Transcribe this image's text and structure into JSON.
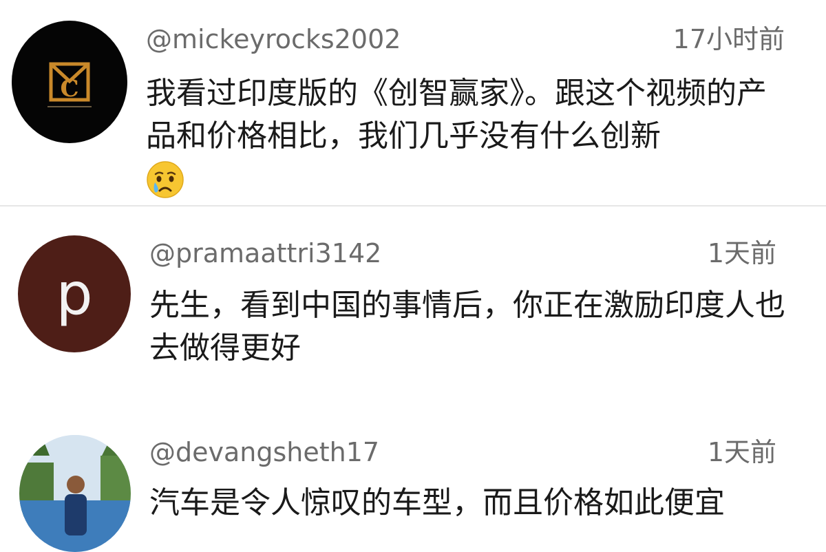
{
  "comments": [
    {
      "username": "@mickeyrocks2002",
      "time": "17小时前",
      "text": "我看过印度版的《创智赢家》。跟这个视频的产品和价格相比，我们几乎没有什么创新",
      "emoji": "crying-face",
      "avatar": {
        "type": "logo",
        "bg": "#050505",
        "accent": "#c9892a"
      }
    },
    {
      "username": "@pramaattri3142",
      "time": "1天前",
      "text": "先生，看到中国的事情后，你正在激励印度人也去做得更好",
      "avatar": {
        "type": "letter",
        "letter": "p",
        "bg": "#4e1e17"
      }
    },
    {
      "username": "@devangsheth17",
      "time": "1天前",
      "text": "汽车是令人惊叹的车型，而且价格如此便宜",
      "avatar": {
        "type": "photo"
      }
    }
  ],
  "colors": {
    "meta": "#6b6b6b",
    "text": "#1a1a1a",
    "divider": "#e6e6e6"
  }
}
